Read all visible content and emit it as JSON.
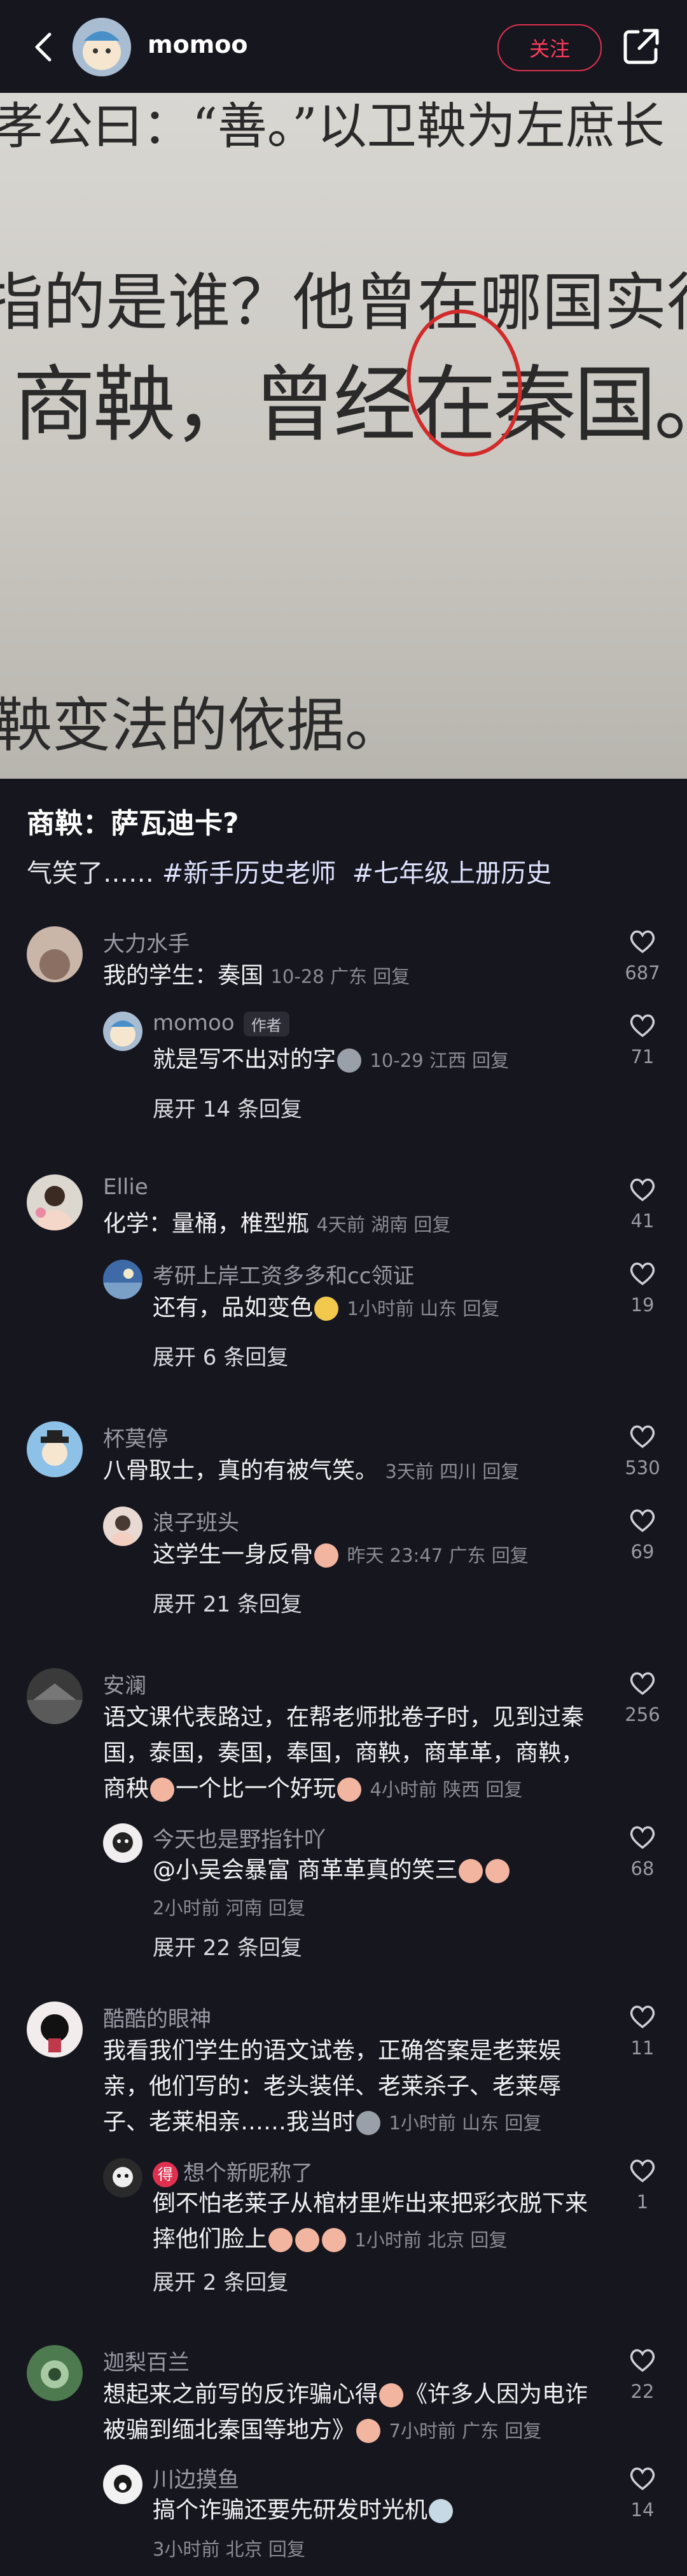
{
  "header": {
    "username": "momoo",
    "follow_label": "关注"
  },
  "photo": {
    "line1": "孝公曰：“善。”以卫鞅为左庶长",
    "line2": "指的是谁？他曾在哪国实行",
    "line3": "商鞅，曾经在秦国。",
    "line4": "鞅变法的依据。"
  },
  "post": {
    "title": "商鞅：萨瓦迪卡?",
    "desc_prefix": "气笑了……",
    "tag1": "#新手历史老师",
    "tag2": "#七年级上册历史"
  },
  "comments": [
    {
      "user": "大力水手",
      "text": "我的学生：奏国",
      "meta": "10-28 广东 回复",
      "likes": "687",
      "reply": {
        "user": "momoo",
        "badge": "作者",
        "text": "就是写不出对的字",
        "meta": "10-29 江西 回复",
        "likes": "71"
      },
      "expand": "展开 14 条回复"
    },
    {
      "user": "Ellie",
      "text": "化学：量桶，椎型瓶",
      "meta": "4天前 湖南 回复",
      "likes": "41",
      "reply": {
        "user": "考研上岸工资多多和cc领证",
        "text": "还有，品如变色",
        "meta": "1小时前 山东 回复",
        "likes": "19"
      },
      "expand": "展开 6 条回复"
    },
    {
      "user": "杯莫停",
      "text": "八骨取士，真的有被气笑。",
      "meta": "3天前 四川 回复",
      "likes": "530",
      "reply": {
        "user": "浪子班头",
        "text": "这学生一身反骨",
        "meta": "昨天 23:47 广东 回复",
        "likes": "69"
      },
      "expand": "展开 21 条回复"
    },
    {
      "user": "安澜",
      "text1": "语文课代表路过，在帮老师批卷子时，见到过秦",
      "text2": "国，泰国，奏国，奉国，商鞅，商革革，商鞅，",
      "text3": "商秧",
      "text3b": "一个比一个好玩",
      "meta": "4小时前 陕西 回复",
      "likes": "256",
      "reply": {
        "user": "今天也是野指针吖",
        "text": "@小吴会暴富 商革革真的笑三",
        "meta": "2小时前 河南 回复",
        "likes": "68"
      },
      "expand": "展开 22 条回复"
    },
    {
      "user": "酷酷的眼神",
      "text1": "我看我们学生的语文试卷，正确答案是老莱娱",
      "text2": "亲，他们写的：老头装佯、老莱杀子、老莱辱",
      "text3": "子、老莱相亲……我当时",
      "meta": "1小时前 山东 回复",
      "likes": "11",
      "reply": {
        "badge_icon": "得",
        "user": "想个新昵称了",
        "text1": "倒不怕老莱子从棺材里炸出来把彩衣脱下来",
        "text2": "摔他们脸上",
        "meta": "1小时前 北京 回复",
        "likes": "1"
      },
      "expand": "展开 2 条回复"
    },
    {
      "user": "迦梨百兰",
      "text1": "想起来之前写的反诈骗心得",
      "text1b": "《许多人因为电诈",
      "text2": "被骗到缅北秦国等地方》",
      "meta": "7小时前 广东 回复",
      "likes": "22",
      "reply": {
        "user": "川边摸鱼",
        "text": "搞个诈骗还要先研发时光机",
        "meta": "3小时前 北京 回复",
        "likes": "14"
      }
    }
  ],
  "colors": {
    "background": "#16161e",
    "follow_accent": "#ff3b5c",
    "circle_red": "#d22b2b"
  }
}
